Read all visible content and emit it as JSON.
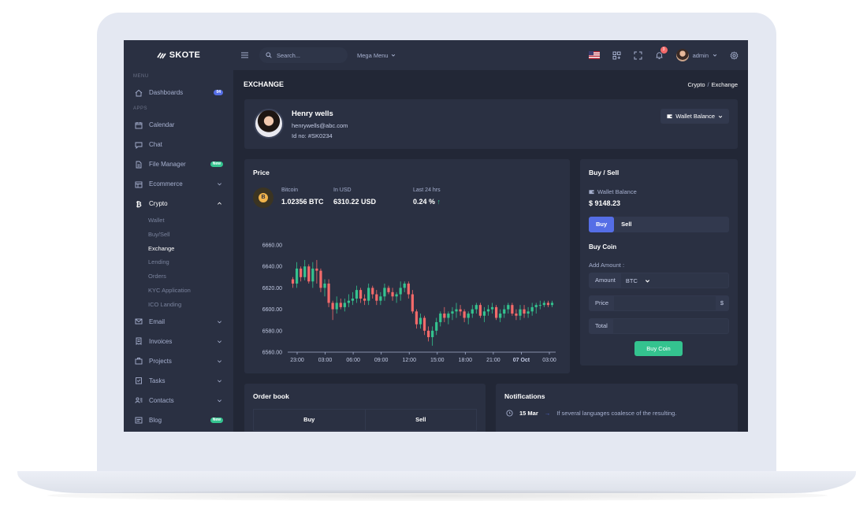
{
  "app": {
    "brand": "SKOTE"
  },
  "topbar": {
    "search_placeholder": "Search...",
    "mega_menu": "Mega Menu",
    "notif_count": "3",
    "user": "admin"
  },
  "sidebar": {
    "menu_title": "Menu",
    "apps_title": "Apps",
    "dashboards": {
      "label": "Dashboards",
      "badge": "04"
    },
    "items": [
      {
        "label": "Calendar"
      },
      {
        "label": "Chat"
      },
      {
        "label": "File Manager",
        "badge": "New"
      },
      {
        "label": "Ecommerce"
      }
    ],
    "crypto": {
      "label": "Crypto",
      "sub": [
        "Wallet",
        "Buy/Sell",
        "Exchange",
        "Lending",
        "Orders",
        "KYC Application",
        "ICO Landing"
      ]
    },
    "more": [
      {
        "label": "Email"
      },
      {
        "label": "Invoices"
      },
      {
        "label": "Projects"
      },
      {
        "label": "Tasks"
      },
      {
        "label": "Contacts"
      },
      {
        "label": "Blog",
        "badge": "New"
      }
    ]
  },
  "page": {
    "title": "EXCHANGE",
    "breadcrumb": [
      "Crypto",
      "Exchange"
    ]
  },
  "profile": {
    "name": "Henry wells",
    "email": "henrywells@abc.com",
    "id": "Id no: #SK0234",
    "wallet_button": "Wallet Balance"
  },
  "price": {
    "title": "Price",
    "coin_symbol": "B",
    "bitcoin_label": "Bitcoin",
    "bitcoin_value": "1.02356 BTC",
    "usd_label": "In USD",
    "usd_value": "6310.22 USD",
    "change_label": "Last 24 hrs",
    "change_value": "0.24 %",
    "change_arrow": "↑"
  },
  "buysell": {
    "title": "Buy / Sell",
    "wallet_label": "Wallet Balance",
    "wallet_value": "$ 9148.23",
    "tab_buy": "Buy",
    "tab_sell": "Sell",
    "buy_coin_title": "Buy Coin",
    "add_amount": "Add Amount :",
    "amount_label": "Amount",
    "amount_unit": "BTC",
    "price_label": "Price",
    "price_addon": "$",
    "total_label": "Total",
    "button": "Buy Coin"
  },
  "orderbook": {
    "title": "Order book",
    "col_buy": "Buy",
    "col_sell": "Sell"
  },
  "notifications": {
    "title": "Notifications",
    "items": [
      {
        "date": "15 Mar",
        "text": "If several languages coalesce of the resulting."
      }
    ]
  },
  "colors": {
    "bg": "#222736",
    "card": "#2a3042",
    "up": "#34c38f",
    "down": "#f46a6a",
    "primary": "#556ee6"
  },
  "chart_data": {
    "type": "candlestick",
    "ylim": [
      6560,
      6660
    ],
    "y_ticks": [
      "6560.00",
      "6580.00",
      "6600.00",
      "6620.00",
      "6640.00",
      "6660.00"
    ],
    "x_ticks": [
      "23:00",
      "03:00",
      "06:00",
      "09:00",
      "12:00",
      "15:00",
      "18:00",
      "21:00",
      "07 Oct",
      "03:00"
    ],
    "candles": [
      [
        6628,
        6630,
        6620,
        6624
      ],
      [
        6624,
        6644,
        6620,
        6638
      ],
      [
        6638,
        6640,
        6626,
        6630
      ],
      [
        6630,
        6646,
        6627,
        6640
      ],
      [
        6640,
        6642,
        6624,
        6626
      ],
      [
        6626,
        6644,
        6620,
        6638
      ],
      [
        6638,
        6646,
        6624,
        6636
      ],
      [
        6636,
        6638,
        6616,
        6620
      ],
      [
        6620,
        6628,
        6612,
        6624
      ],
      [
        6624,
        6628,
        6602,
        6606
      ],
      [
        6606,
        6608,
        6590,
        6600
      ],
      [
        6600,
        6612,
        6596,
        6606
      ],
      [
        6606,
        6610,
        6600,
        6602
      ],
      [
        6602,
        6610,
        6598,
        6606
      ],
      [
        6606,
        6614,
        6602,
        6608
      ],
      [
        6608,
        6616,
        6604,
        6610
      ],
      [
        6610,
        6622,
        6606,
        6618
      ],
      [
        6618,
        6620,
        6606,
        6610
      ],
      [
        6610,
        6614,
        6604,
        6608
      ],
      [
        6608,
        6624,
        6604,
        6620
      ],
      [
        6620,
        6622,
        6610,
        6614
      ],
      [
        6614,
        6618,
        6604,
        6608
      ],
      [
        6608,
        6616,
        6604,
        6612
      ],
      [
        6612,
        6624,
        6608,
        6620
      ],
      [
        6620,
        6622,
        6614,
        6616
      ],
      [
        6616,
        6620,
        6608,
        6612
      ],
      [
        6612,
        6616,
        6606,
        6614
      ],
      [
        6614,
        6626,
        6608,
        6620
      ],
      [
        6620,
        6626,
        6616,
        6624
      ],
      [
        6624,
        6626,
        6610,
        6614
      ],
      [
        6614,
        6618,
        6596,
        6598
      ],
      [
        6598,
        6600,
        6582,
        6586
      ],
      [
        6586,
        6596,
        6582,
        6592
      ],
      [
        6592,
        6594,
        6576,
        6580
      ],
      [
        6580,
        6584,
        6570,
        6574
      ],
      [
        6574,
        6584,
        6566,
        6580
      ],
      [
        6580,
        6592,
        6576,
        6588
      ],
      [
        6588,
        6598,
        6584,
        6596
      ],
      [
        6596,
        6602,
        6588,
        6592
      ],
      [
        6592,
        6598,
        6586,
        6596
      ],
      [
        6596,
        6602,
        6590,
        6598
      ],
      [
        6598,
        6606,
        6592,
        6600
      ],
      [
        6600,
        6604,
        6594,
        6598
      ],
      [
        6598,
        6600,
        6588,
        6592
      ],
      [
        6592,
        6598,
        6586,
        6596
      ],
      [
        6596,
        6604,
        6592,
        6600
      ],
      [
        6600,
        6606,
        6596,
        6604
      ],
      [
        6604,
        6606,
        6592,
        6594
      ],
      [
        6594,
        6602,
        6588,
        6598
      ],
      [
        6598,
        6604,
        6594,
        6600
      ],
      [
        6600,
        6606,
        6596,
        6602
      ],
      [
        6602,
        6604,
        6590,
        6592
      ],
      [
        6592,
        6600,
        6588,
        6596
      ],
      [
        6596,
        6604,
        6592,
        6600
      ],
      [
        6600,
        6606,
        6596,
        6604
      ],
      [
        6604,
        6606,
        6594,
        6596
      ],
      [
        6596,
        6600,
        6590,
        6594
      ],
      [
        6594,
        6604,
        6590,
        6600
      ],
      [
        6600,
        6604,
        6592,
        6596
      ],
      [
        6596,
        6602,
        6592,
        6598
      ],
      [
        6598,
        6606,
        6594,
        6602
      ],
      [
        6602,
        6606,
        6596,
        6604
      ],
      [
        6604,
        6608,
        6600,
        6604
      ],
      [
        6604,
        6608,
        6602,
        6606
      ],
      [
        6606,
        6608,
        6602,
        6604
      ],
      [
        6604,
        6608,
        6602,
        6606
      ]
    ]
  }
}
